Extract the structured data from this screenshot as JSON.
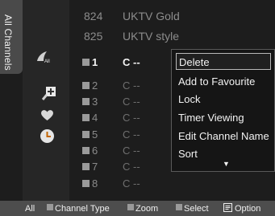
{
  "side_tab": {
    "label": "All Channels"
  },
  "top_channels": [
    {
      "number": "824",
      "name": "UKTV Gold"
    },
    {
      "number": "825",
      "name": "UKTV style"
    }
  ],
  "channel_rows": [
    {
      "number": "1",
      "name": "C --",
      "selected": true
    },
    {
      "number": "2",
      "name": "C --"
    },
    {
      "number": "3",
      "name": "C --"
    },
    {
      "number": "4",
      "name": "C --"
    },
    {
      "number": "5",
      "name": "C --"
    },
    {
      "number": "6",
      "name": "C --"
    },
    {
      "number": "7",
      "name": "C --"
    },
    {
      "number": "8",
      "name": "C --"
    }
  ],
  "menu": {
    "items": [
      "Delete",
      "Add to Favourite",
      "Lock",
      "Timer Viewing",
      "Edit Channel Name",
      "Sort"
    ],
    "highlighted": "Delete",
    "more_arrow": "▼"
  },
  "bottom_bar": {
    "all_label": "All",
    "channel_type_label": "Channel Type",
    "zoom_label": "Zoom",
    "select_label": "Select",
    "option_label": "Option"
  },
  "icons": {
    "all": "all-channels-icon",
    "added": "added-channels-icon",
    "favourite": "favourite-heart-icon",
    "timer": "timer-clock-icon",
    "option": "option-menu-icon"
  }
}
